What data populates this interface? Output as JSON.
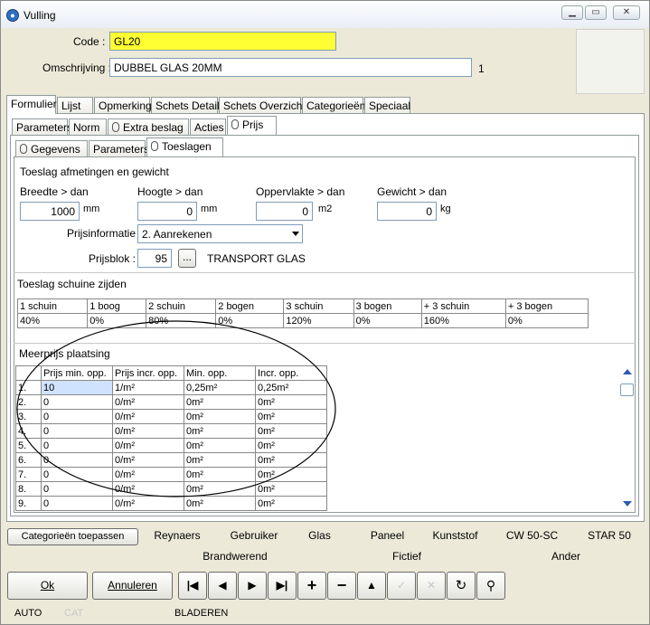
{
  "window": {
    "title": "Vulling"
  },
  "form": {
    "code_label": "Code :",
    "code_value": "GL20",
    "desc_label": "Omschrijving :",
    "desc_value": "DUBBEL GLAS 20MM",
    "desc_count": "1"
  },
  "tabs_main": [
    "Formulier",
    "Lijst",
    "Opmerking",
    "Schets Detail",
    "Schets Overzicht",
    "Categorieën",
    "Speciaal"
  ],
  "tabs_sub": [
    "Parameters",
    "Norm",
    "Extra beslag",
    "Acties",
    "Prijs"
  ],
  "tabs_inner": [
    "Gegevens",
    "Parameters",
    "Toeslagen"
  ],
  "toeslag": {
    "section_title": "Toeslag afmetingen en gewicht",
    "breedte_label": "Breedte > dan",
    "breedte_value": "1000",
    "breedte_unit": "mm",
    "hoogte_label": "Hoogte > dan",
    "hoogte_value": "0",
    "hoogte_unit": "mm",
    "opp_label": "Oppervlakte > dan",
    "opp_value": "0",
    "opp_unit": "m2",
    "gewicht_label": "Gewicht > dan",
    "gewicht_value": "0",
    "gewicht_unit": "kg",
    "prijsinfo_label": "Prijsinformatie :",
    "prijsinfo_value": "2. Aanrekenen",
    "prijsblok_label": "Prijsblok :",
    "prijsblok_value": "95",
    "prijsblok_btn": "...",
    "prijsblok_desc": "TRANSPORT GLAS"
  },
  "schuine": {
    "section_title": "Toeslag schuine zijden",
    "headers": [
      "1 schuin",
      "1 boog",
      "2 schuin",
      "2 bogen",
      "3 schuin",
      "3 bogen",
      "+ 3 schuin",
      "+ 3 bogen"
    ],
    "values": [
      "40%",
      "0%",
      "80%",
      "0%",
      "120%",
      "0%",
      "160%",
      "0%"
    ]
  },
  "meerprijs": {
    "section_title": "Meerprijs plaatsing",
    "headers": [
      "Prijs min. opp.",
      "Prijs incr. opp.",
      "Min. opp.",
      "Incr. opp."
    ],
    "rows": [
      [
        "1.",
        "10",
        "1/m²",
        "0,25m²",
        "0,25m²"
      ],
      [
        "2.",
        "0",
        "0/m²",
        "0m²",
        "0m²"
      ],
      [
        "3.",
        "0",
        "0/m²",
        "0m²",
        "0m²"
      ],
      [
        "4.",
        "0",
        "0/m²",
        "0m²",
        "0m²"
      ],
      [
        "5.",
        "0",
        "0/m²",
        "0m²",
        "0m²"
      ],
      [
        "6.",
        "0",
        "0/m²",
        "0m²",
        "0m²"
      ],
      [
        "7.",
        "0",
        "0/m²",
        "0m²",
        "0m²"
      ],
      [
        "8.",
        "0",
        "0/m²",
        "0m²",
        "0m²"
      ],
      [
        "9.",
        "0",
        "0/m²",
        "0m²",
        "0m²"
      ]
    ]
  },
  "category_bar": {
    "apply_label": "Categorieën toepassen",
    "row1": [
      "Reynaers",
      "Gebruiker",
      "Glas",
      "Paneel",
      "Kunststof",
      "CW 50-SC",
      "STAR 50"
    ],
    "row2": [
      "Brandwerend",
      "Fictief",
      "Ander"
    ]
  },
  "buttons": {
    "ok": "Ok",
    "cancel": "Annuleren"
  },
  "status": {
    "left": "AUTO",
    "middle": "CAT",
    "right": "BLADEREN"
  }
}
